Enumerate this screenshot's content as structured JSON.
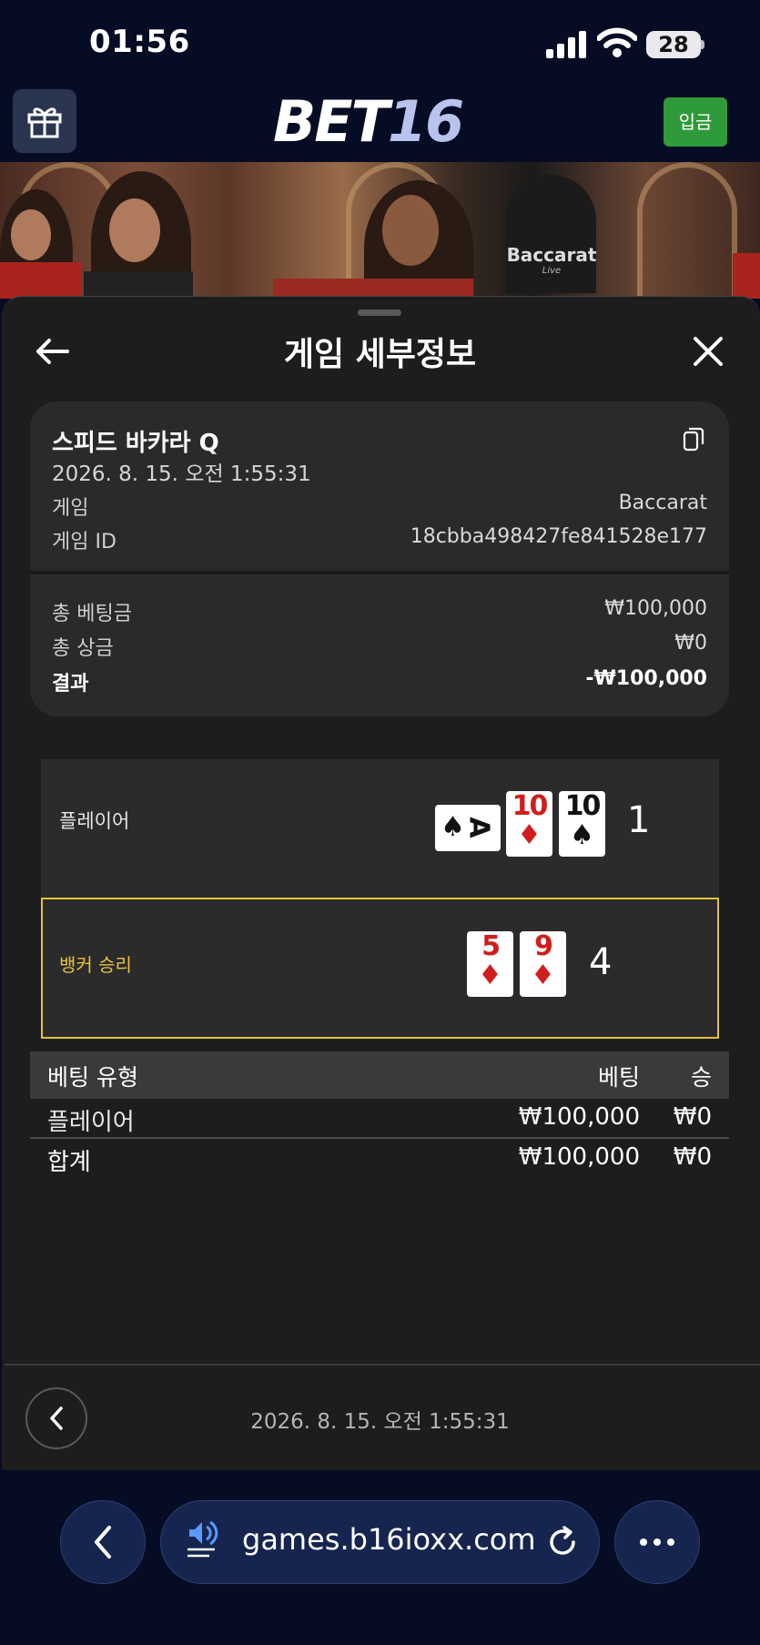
{
  "status_bar": {
    "time": "01:56",
    "battery": "28"
  },
  "header": {
    "logo_main": "BET",
    "logo_num": "16",
    "deposit_label": "입금"
  },
  "banner": {
    "sign_text": "Baccarat",
    "sign_sub": "Live"
  },
  "sheet": {
    "title": "게임 세부정보"
  },
  "game_info": {
    "name": "스피드 바카라 Q",
    "datetime": "2026. 8. 15. 오전 1:55:31",
    "game_label": "게임",
    "game_value": "Baccarat",
    "id_label": "게임 ID",
    "id_value": "18cbba498427fe841528e177"
  },
  "totals": {
    "bet_label": "총 베팅금",
    "bet_value": "₩100,000",
    "prize_label": "총 상금",
    "prize_value": "₩0",
    "result_label": "결과",
    "result_value": "-₩100,000"
  },
  "result_board": {
    "player": {
      "label": "플레이어",
      "cards": [
        {
          "rank": "A",
          "suit": "♠",
          "color": "black",
          "rotated": true
        },
        {
          "rank": "10",
          "suit": "♦",
          "color": "red",
          "rotated": false
        },
        {
          "rank": "10",
          "suit": "♠",
          "color": "black",
          "rotated": false
        }
      ],
      "score": "1"
    },
    "banker": {
      "label": "뱅커 승리",
      "cards": [
        {
          "rank": "5",
          "suit": "♦",
          "color": "red"
        },
        {
          "rank": "9",
          "suit": "♦",
          "color": "red"
        }
      ],
      "score": "4"
    }
  },
  "bet_table": {
    "headers": {
      "type": "베팅 유형",
      "bet": "베팅",
      "win": "승"
    },
    "rows": [
      {
        "type": "플레이어",
        "bet": "₩100,000",
        "win": "₩0"
      }
    ],
    "total": {
      "type": "합계",
      "bet": "₩100,000",
      "win": "₩0"
    }
  },
  "footer": {
    "datetime": "2026. 8. 15. 오전 1:55:31"
  },
  "browser": {
    "url": "games.b16ioxx.com"
  },
  "colors": {
    "accent_green": "#2f9a39",
    "banker_highlight": "#e2c13c",
    "card_red": "#d11d1d"
  }
}
